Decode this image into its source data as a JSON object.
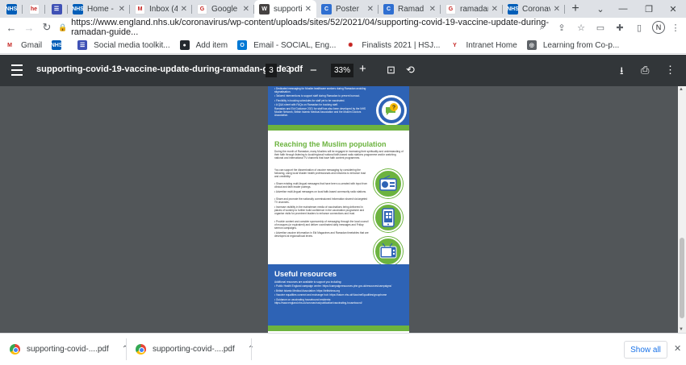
{
  "tabs": [
    {
      "label": "",
      "icon": "nhs-icon",
      "color": "#005eb8",
      "glyph": "NHS",
      "pinned": true
    },
    {
      "label": "",
      "icon": "he-icon",
      "color": "#ffffff",
      "glyph": "he",
      "pinned": true
    },
    {
      "label": "",
      "icon": "form-icon",
      "color": "#3f51b5",
      "glyph": "☰",
      "pinned": true
    },
    {
      "label": "Home - (",
      "icon": "nhs-icon",
      "color": "#005eb8",
      "glyph": "NHS",
      "pinned": false
    },
    {
      "label": "Inbox (4",
      "icon": "gmail-icon",
      "color": "#ffffff",
      "glyph": "M",
      "pinned": false
    },
    {
      "label": "Google C",
      "icon": "google-icon",
      "color": "#ffffff",
      "glyph": "G",
      "pinned": false
    },
    {
      "label": "supporti",
      "icon": "wordpress-icon",
      "color": "#464342",
      "glyph": "W",
      "pinned": false,
      "active": true
    },
    {
      "label": "Poster",
      "icon": "edge-icon",
      "color": "#2f6fd1",
      "glyph": "C",
      "pinned": false
    },
    {
      "label": "Ramad",
      "icon": "edge-icon",
      "color": "#2f6fd1",
      "glyph": "C",
      "pinned": false
    },
    {
      "label": "ramadan",
      "icon": "google-icon",
      "color": "#ffffff",
      "glyph": "G",
      "pinned": false
    },
    {
      "label": "Coronav",
      "icon": "nhs-icon",
      "color": "#005eb8",
      "glyph": "NHS",
      "pinned": false
    }
  ],
  "address": {
    "url": "https://www.england.nhs.uk/coronavirus/wp-content/uploads/sites/52/2021/04/supporting-covid-19-vaccine-update-during-ramadan-guide...",
    "profile_initial": "N"
  },
  "bookmarks": [
    {
      "label": "Gmail",
      "icon": "gmail-icon",
      "color": "#ffffff",
      "glyph": "M"
    },
    {
      "label": "",
      "icon": "nhs-icon",
      "color": "#005eb8",
      "glyph": "NHS"
    },
    {
      "label": "Social media toolkit...",
      "icon": "form-icon",
      "color": "#3f51b5",
      "glyph": "☰"
    },
    {
      "label": "Add item",
      "icon": "github-icon",
      "color": "#24292e",
      "glyph": "●"
    },
    {
      "label": "Email - SOCIAL, Eng...",
      "icon": "outlook-icon",
      "color": "#0078d4",
      "glyph": "O"
    },
    {
      "label": "Finalists 2021 | HSJ...",
      "icon": "hsj-icon",
      "color": "#ffffff",
      "glyph": "✺"
    },
    {
      "label": "Intranet Home",
      "icon": "intranet-icon",
      "color": "#ffffff",
      "glyph": "Y"
    },
    {
      "label": "Learning from Co-p...",
      "icon": "globe-icon",
      "color": "#5f6368",
      "glyph": "◎"
    }
  ],
  "pdf": {
    "filename": "supporting-covid-19-vaccine-update-during-ramadan-guide.pdf",
    "current_page": "3",
    "total_pages": "3",
    "page_separator": "/",
    "zoom": "33%",
    "top_bullets": [
      "• Dedicated messaging for Muslim healthcare workers during Ramadan avoiding stigmatisation.",
      "• Tailored interventions to support staff during Ramadan to prevent burnout.",
      "• Flexibility in booking schedules for staff yet to be vaccinated.",
      "• A Q&A sheet with FAQs on Ramadan for booking staff.",
      "Ramadan and Eid Guidance 2021 for staff has also been developed by the NHS Muslim Network, British Islamic Medical Association and the Muslim Doctors Association."
    ],
    "section_heading": "Reaching the Muslim population",
    "intro": "During the month of Ramadan, many Muslims will be engaged in increasing their spirituality and understanding of their faith through listening to local/regional/ national faith-based radio stations programme and/or watching national and international TV channels that have faith content programmes.",
    "support_text": "You can support the dissemination of vaccine messaging by considering the following, using local Muslim health professionals and networks to enhance trust and credibility:",
    "bullets": [
      "• Share existing multi-lingual messages that have been co-created with input from clinical and faith leader pairings.",
      "• Advertise multi-lingual messages on local faith-based community radio stations.",
      "• Share and promote the nationally commissioned information shared via targeted TV channels.",
      "• Increase visibility in the mainstream media of vaccinations being delivered in places of worship to further build confidence in the vaccination programme and organise visits for prominent leaders to enhance connections and trust.",
      "• Provide content and consider sponsorship of messaging through the local council of mosques (or equivalent) and deliver coordinated daily messages and Friday sermon campaigns.",
      "• Advertise vaccine information in Eid Magazines and Ramadan timetables that are developed at regional/local levels."
    ],
    "resources_heading": "Useful resources",
    "resources_intro": "Additional resources are available to support you including:",
    "resources": [
      "• Public Health England campaign centre: https://campaignresources.phe.gov.uk/resources/campaigns/",
      "• British Islamic Medical Association: https://britishima.org",
      "• Vaccine equalities connect and exchange hub: https://future.nhs.uk/VaccineEqualities/grouphome",
      "• Guidance on vaccinating housebound residents: https://www.england.nhs.uk/coronavirus/publication/vaccinating-housebound/"
    ]
  },
  "downloads": {
    "items": [
      "supporting-covid-....pdf",
      "supporting-covid-....pdf"
    ],
    "show_all_label": "Show all"
  }
}
